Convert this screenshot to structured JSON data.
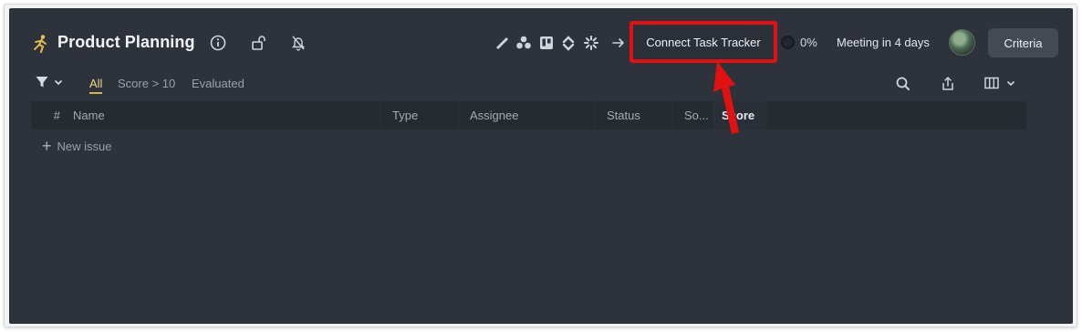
{
  "header": {
    "title": "Product Planning",
    "connect_label": "Connect Task Tracker",
    "progress": "0%",
    "meeting": "Meeting in 4 days",
    "criteria_label": "Criteria"
  },
  "toolbar": {
    "tabs": [
      "All",
      "Score > 10",
      "Evaluated"
    ],
    "active_tab": "All"
  },
  "table": {
    "columns": [
      "#",
      "Name",
      "Type",
      "Assignee",
      "Status",
      "So...",
      "Score"
    ],
    "new_issue_label": "New issue"
  },
  "colors": {
    "background": "#2d323b",
    "highlight": "#e01111",
    "active_tab": "#f0d78a"
  }
}
